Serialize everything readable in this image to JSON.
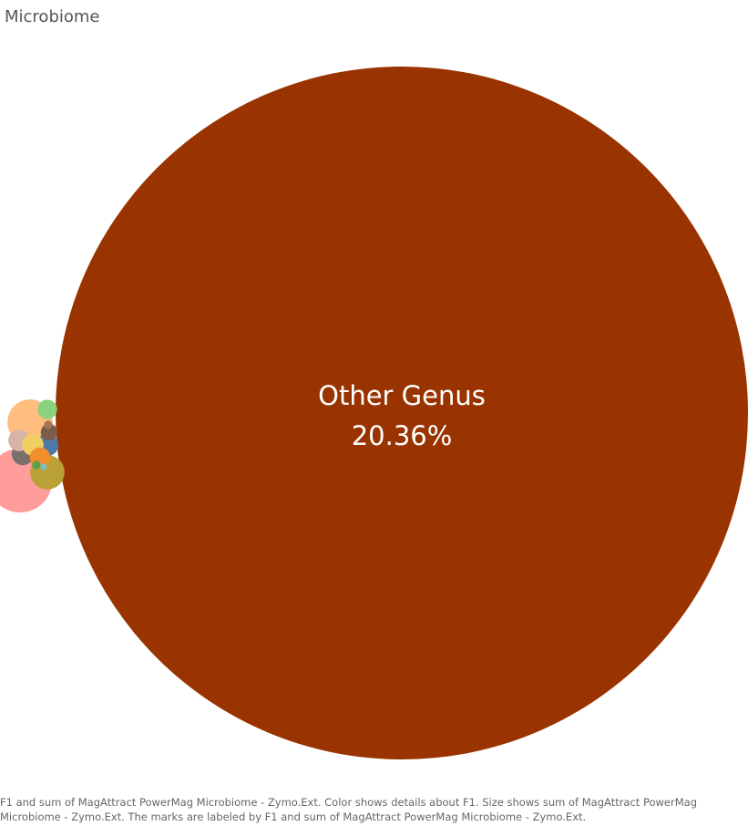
{
  "title": "Microbiome",
  "caption": "F1 and sum of MagAttract PowerMag Microbiome - Zymo.Ext.  Color shows details about F1.  Size shows sum of MagAttract PowerMag Microbiome - Zymo.Ext.  The marks are labeled by F1 and sum of MagAttract PowerMag Microbiome - Zymo.Ext.",
  "chart_data": {
    "type": "packed-bubble",
    "title": "Microbiome",
    "measure": "sum of MagAttract PowerMag Microbiome - Zymo.Ext.",
    "unit": "%",
    "bubbles": [
      {
        "label": "Other Genus",
        "value": 20.36,
        "value_label": "20.36%",
        "color": "#993300"
      },
      {
        "label": "",
        "value": 0.175,
        "color": "#ff9d9a"
      },
      {
        "label": "",
        "value": 0.087,
        "color": "#ffbe7d"
      },
      {
        "label": "",
        "value": 0.05,
        "color": "#b9a136"
      },
      {
        "label": "",
        "value": 0.021,
        "color": "#4e79a7"
      },
      {
        "label": "",
        "value": 0.021,
        "color": "#79706e"
      },
      {
        "label": "",
        "value": 0.02,
        "color": "#d7b5a6"
      },
      {
        "label": "",
        "value": 0.02,
        "color": "#f1ce63"
      },
      {
        "label": "",
        "value": 0.018,
        "color": "#f28e2b"
      },
      {
        "label": "",
        "value": 0.016,
        "color": "#8cd17d"
      },
      {
        "label": "",
        "value": 0.012,
        "color": "#7d5c4b"
      },
      {
        "label": "",
        "value": 0.003,
        "color": "#a0765f"
      },
      {
        "label": "",
        "value": 0.003,
        "color": "#59a14f"
      },
      {
        "label": "",
        "value": 0.002,
        "color": "#86bcb6"
      }
    ]
  }
}
